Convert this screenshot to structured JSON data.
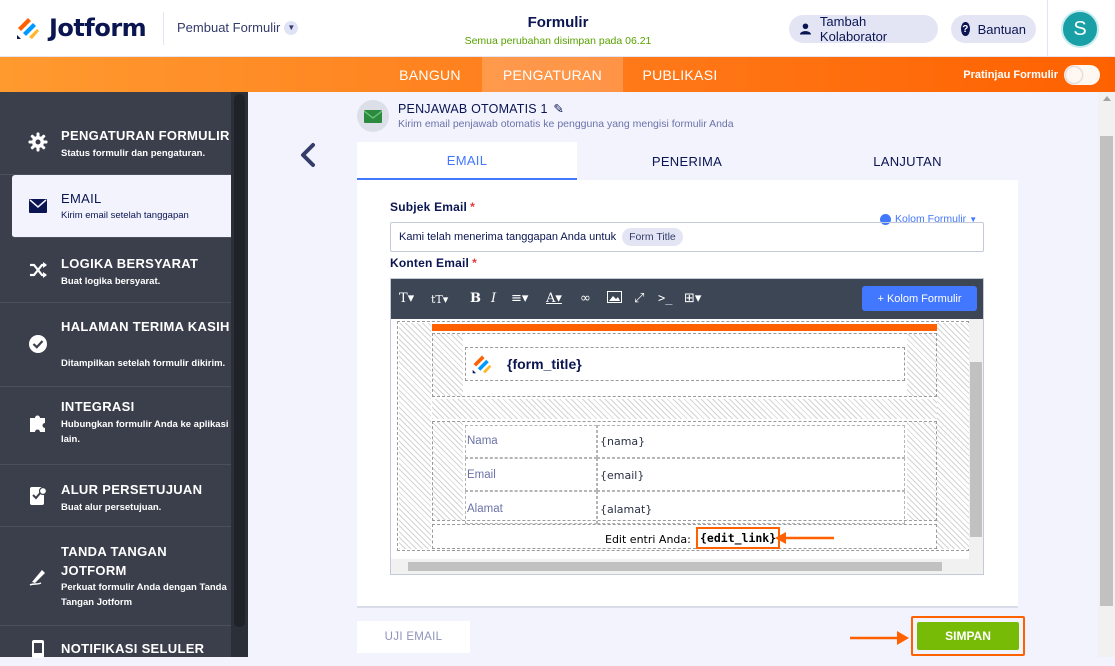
{
  "brand": {
    "name": "Jotform",
    "builder_label": "Pembuat Formulir"
  },
  "header": {
    "title": "Formulir",
    "save_status": "Semua perubahan disimpan pada 06.21",
    "collab_label": "Tambah Kolaborator",
    "help_label": "Bantuan",
    "avatar_initial": "S"
  },
  "tabs": [
    {
      "label": "BANGUN",
      "active": false
    },
    {
      "label": "PENGATURAN",
      "active": true
    },
    {
      "label": "PUBLIKASI",
      "active": false
    }
  ],
  "preview_label": "Pratinjau Formulir",
  "sidebar": {
    "items": [
      {
        "title": "PENGATURAN FORMULIR",
        "desc": "Status formulir dan pengaturan.",
        "icon": "gear-icon"
      },
      {
        "title": "EMAIL",
        "desc": "Kirim email setelah tanggapan",
        "icon": "envelope-icon",
        "active": true
      },
      {
        "title": "LOGIKA BERSYARAT",
        "desc": "Buat logika bersyarat.",
        "icon": "shuffle-icon"
      },
      {
        "title": "HALAMAN TERIMA KASIH",
        "desc": "Ditampilkan setelah formulir dikirim.",
        "icon": "check-circle-icon"
      },
      {
        "title": "INTEGRASI",
        "desc": "Hubungkan formulir Anda ke aplikasi lain.",
        "icon": "puzzle-icon"
      },
      {
        "title": "ALUR PERSETUJUAN",
        "desc": "Buat alur persetujuan.",
        "icon": "approval-icon"
      },
      {
        "title": "TANDA TANGAN JOTFORM",
        "desc": "Perkuat formulir Anda dengan Tanda Tangan Jotform",
        "icon": "signature-icon"
      },
      {
        "title": "NOTIFIKASI SELULER",
        "desc": "",
        "icon": "mobile-icon"
      }
    ]
  },
  "autoresponder": {
    "title": "PENJAWAB OTOMATIS 1",
    "subtitle": "Kirim email penjawab otomatis ke pengguna yang mengisi formulir Anda"
  },
  "panel_tabs": [
    {
      "label": "EMAIL",
      "active": true
    },
    {
      "label": "PENERIMA",
      "active": false
    },
    {
      "label": "LANJUTAN",
      "active": false
    }
  ],
  "subject": {
    "label": "Subjek Email",
    "required_mark": "*",
    "value": "Kami telah menerima tanggapan Anda untuk",
    "chip": "Form Title",
    "form_fields_link": "Kolom Formulir"
  },
  "content": {
    "label": "Konten Email",
    "required_mark": "*",
    "insert_fields_button": "+ Kolom Formulir"
  },
  "email_body": {
    "form_title_token": "{form_title}",
    "rows": [
      {
        "field": "Nama",
        "value": "{nama}"
      },
      {
        "field": "Email",
        "value": "{email}"
      },
      {
        "field": "Alamat",
        "value": "{alamat}"
      }
    ],
    "edit_text": "Edit entri Anda:",
    "edit_link": "{edit_link}"
  },
  "buttons": {
    "test": "UJI EMAIL",
    "save": "SIMPAN"
  },
  "colors": {
    "accent": "#4277ff",
    "orange": "#ff6100",
    "save_green": "#78bb07",
    "sidebar": "#3a3f4b"
  }
}
